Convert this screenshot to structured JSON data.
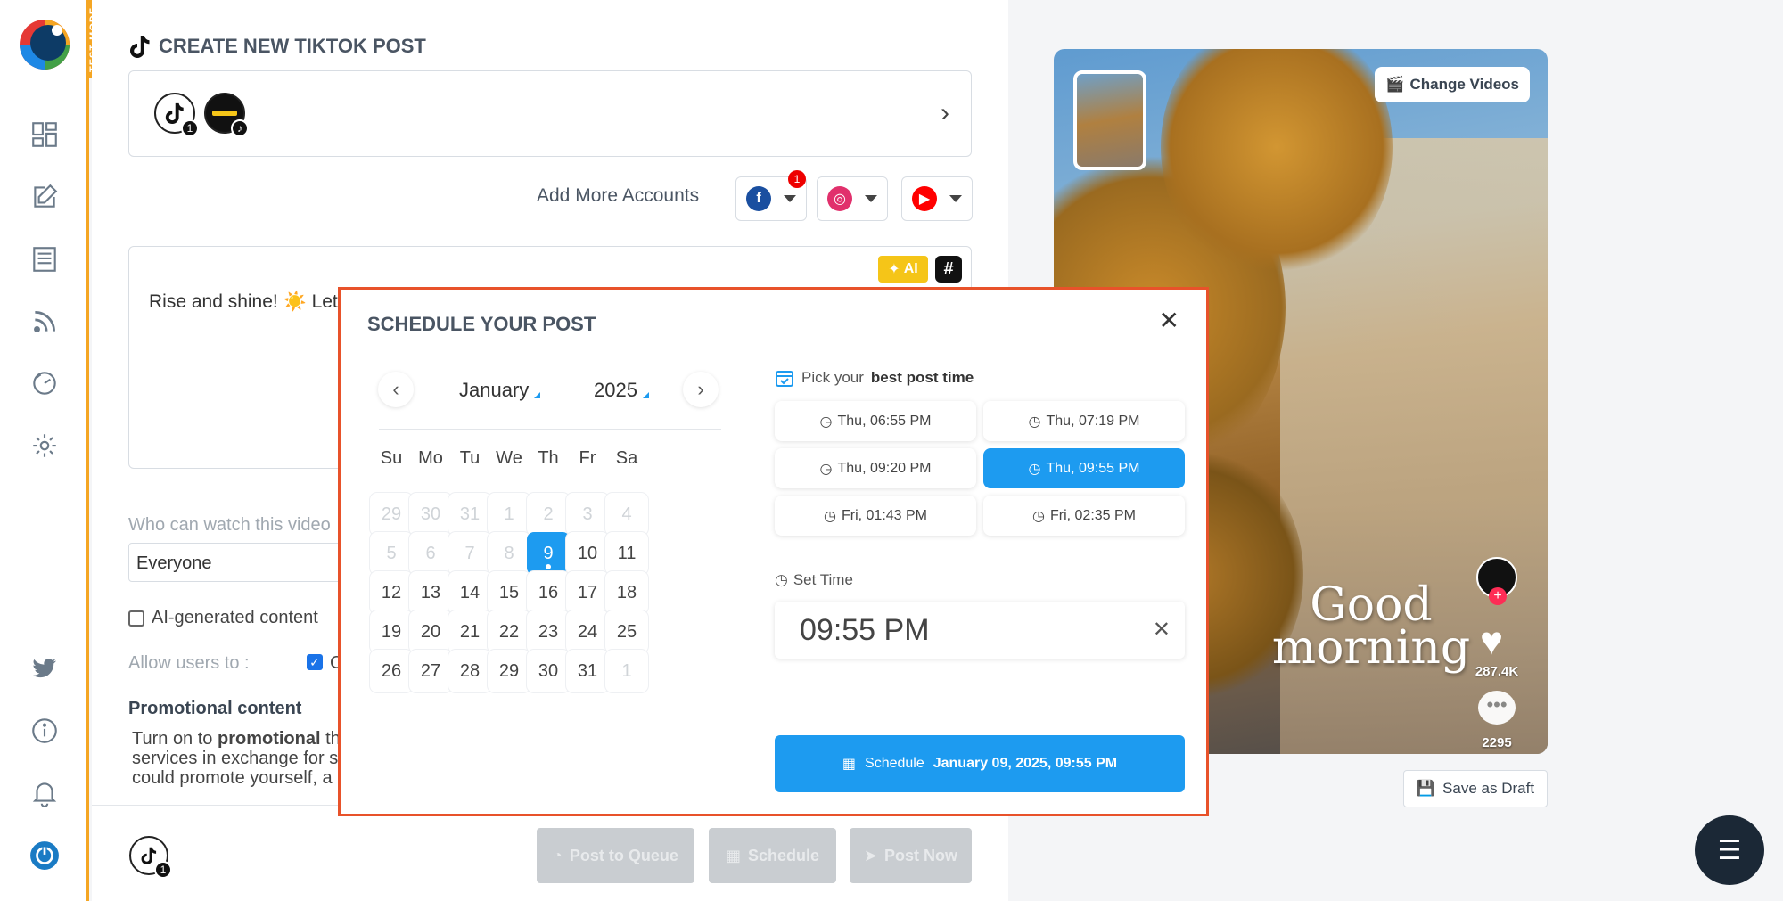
{
  "sidebar": {
    "test_mode": "TEST MODE",
    "icons": [
      "dashboard-icon",
      "compose-icon",
      "posts-icon",
      "rss-icon",
      "analytics-icon",
      "settings-icon",
      "twitter-icon",
      "info-icon",
      "bell-icon",
      "power-icon"
    ]
  },
  "header": {
    "title": "CREATE NEW TIKTOK POST"
  },
  "accounts": {
    "badge_count": "1",
    "add_more_label": "Add More Accounts",
    "facebook_badge": "1"
  },
  "caption": {
    "text": "Rise and shine! ☀️  Let",
    "ai_label": "AI",
    "hashtag_label": "#"
  },
  "privacy": {
    "who_label": "Who can watch this video",
    "who_value": "Everyone",
    "ai_generated_label": "AI-generated content",
    "allow_label": "Allow users to :",
    "allow_option_initial": "C"
  },
  "promotional": {
    "title": "Promotional content",
    "line1_prefix": "Turn on to ",
    "line1_bold": "promotional",
    "line1_suffix": " th",
    "line2": "services in exchange for s",
    "line3": "could promote yourself, a"
  },
  "bottom_bar": {
    "avatar_badge": "1",
    "post_to_queue": "Post to Queue",
    "schedule": "Schedule",
    "post_now": "Post Now"
  },
  "preview": {
    "change_videos": "Change Videos",
    "overlay_line1": "Good",
    "overlay_line2": "morning",
    "likes": "287.4K",
    "comments": "2295",
    "save_draft": "Save as Draft"
  },
  "modal": {
    "title": "SCHEDULE YOUR POST",
    "month": "January",
    "year": "2025",
    "weekdays": [
      "Su",
      "Mo",
      "Tu",
      "We",
      "Th",
      "Fr",
      "Sa"
    ],
    "weeks": [
      [
        "29",
        "30",
        "31",
        "1",
        "2",
        "3",
        "4"
      ],
      [
        "5",
        "6",
        "7",
        "8",
        "9",
        "10",
        "11"
      ],
      [
        "12",
        "13",
        "14",
        "15",
        "16",
        "17",
        "18"
      ],
      [
        "19",
        "20",
        "21",
        "22",
        "23",
        "24",
        "25"
      ],
      [
        "26",
        "27",
        "28",
        "29",
        "30",
        "31",
        "1"
      ]
    ],
    "selected_day": "9",
    "pick_prefix": "Pick your",
    "pick_bold": "best post time",
    "slots": [
      "Thu, 06:55 PM",
      "Thu, 07:19 PM",
      "Thu, 09:20 PM",
      "Thu, 09:55 PM",
      "Fri, 01:43 PM",
      "Fri, 02:35 PM"
    ],
    "active_slot": "Thu, 09:55 PM",
    "set_time_label": "Set Time",
    "time_value": "09:55 PM",
    "schedule_label": "Schedule",
    "schedule_value": "January 09, 2025, 09:55 PM"
  },
  "colors": {
    "accent": "#1d9bf0",
    "test_mode": "#f5a623",
    "modal_border": "#e8522a"
  }
}
